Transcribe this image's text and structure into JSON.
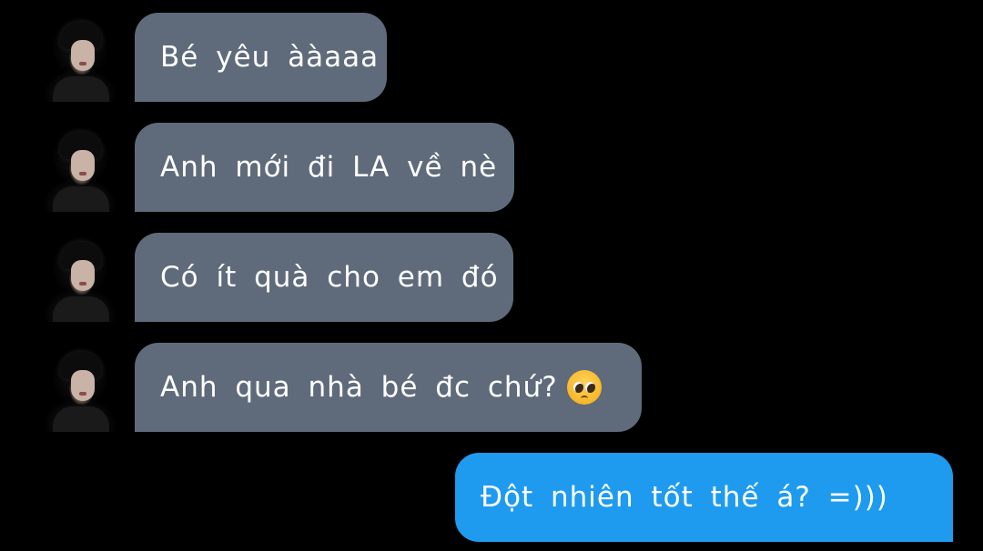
{
  "colors": {
    "background": "#000000",
    "incoming_bubble": "#5f6b7a",
    "outgoing_bubble": "#1e9bef",
    "text": "#ffffff"
  },
  "messages": [
    {
      "direction": "incoming",
      "text": "Bé yêu ààaaa",
      "avatar_icon": "avatar-photo-icon"
    },
    {
      "direction": "incoming",
      "text": "Anh mới đi LA về nè",
      "avatar_icon": "avatar-photo-icon"
    },
    {
      "direction": "incoming",
      "text": "Có ít quà cho em đó",
      "avatar_icon": "avatar-photo-icon"
    },
    {
      "direction": "incoming",
      "text": "Anh qua nhà bé đc chứ?",
      "emoji": "pleading-face-emoji",
      "avatar_icon": "avatar-photo-icon"
    },
    {
      "direction": "outgoing",
      "text": "Đột nhiên tốt thế á? =)))"
    }
  ]
}
